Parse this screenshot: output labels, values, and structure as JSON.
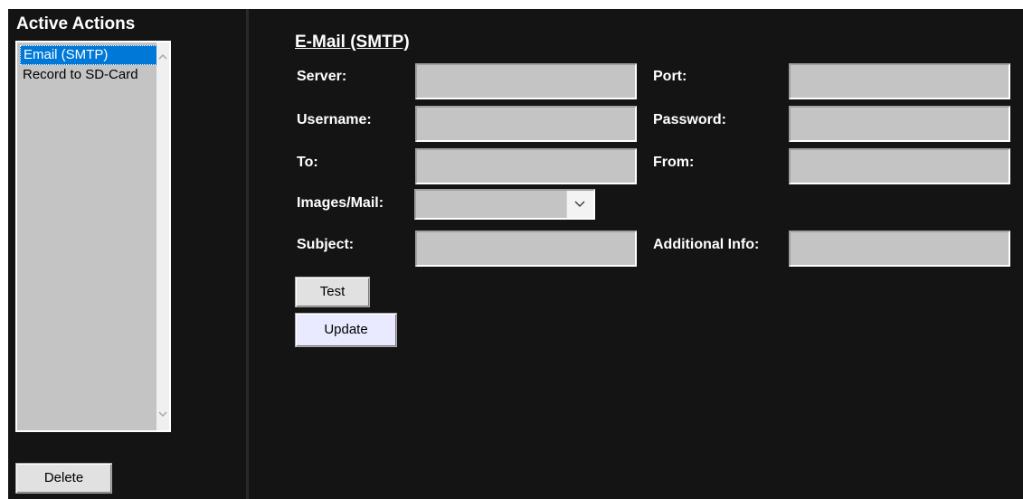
{
  "left_panel": {
    "title": "Active Actions",
    "list_items": [
      "Email (SMTP)",
      "Record to SD-Card"
    ],
    "selected_index": 0,
    "delete_label": "Delete"
  },
  "main": {
    "section_title": "E-Mail (SMTP)",
    "fields": {
      "server": {
        "label": "Server:",
        "value": ""
      },
      "port": {
        "label": "Port:",
        "value": ""
      },
      "username": {
        "label": "Username:",
        "value": ""
      },
      "password": {
        "label": "Password:",
        "value": ""
      },
      "to": {
        "label": "To:",
        "value": ""
      },
      "from": {
        "label": "From:",
        "value": ""
      },
      "images_per_mail": {
        "label": "Images/Mail:",
        "value": ""
      },
      "subject": {
        "label": "Subject:",
        "value": ""
      },
      "additional_info": {
        "label": "Additional Info:",
        "value": ""
      }
    },
    "test_label": "Test",
    "update_label": "Update"
  },
  "icons": {
    "scroll_up": "chevron-up-icon",
    "scroll_down": "chevron-down-icon",
    "dropdown": "chevron-down-icon"
  },
  "colors": {
    "panel_background": "#141414",
    "field_background": "#c4c4c4",
    "selection": "#0078d7",
    "update_button": "#e9e9ff"
  }
}
